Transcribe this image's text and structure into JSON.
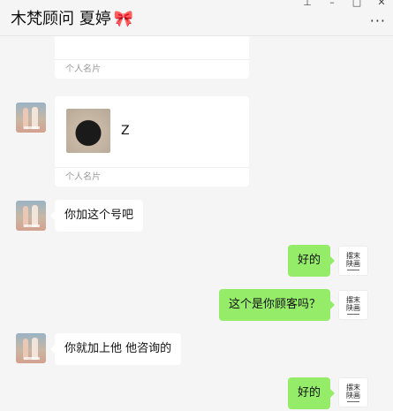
{
  "header": {
    "title": "木梵顾问 夏婷",
    "title_emoji": "🎀",
    "more_icon": "more-dots-icon",
    "window_controls": [
      "pin-icon",
      "minimize-icon",
      "maximize-icon",
      "close-icon"
    ]
  },
  "messages": [
    {
      "type": "contact_card",
      "side": "left",
      "footer": "个人名片",
      "truncated_top": true
    },
    {
      "type": "contact_card",
      "side": "left",
      "name": "Z",
      "footer": "个人名片"
    },
    {
      "type": "text",
      "side": "left",
      "text": "你加这个号吧"
    },
    {
      "type": "text",
      "side": "right",
      "text": "好的"
    },
    {
      "type": "text",
      "side": "right",
      "text": "这个是你顾客吗？"
    },
    {
      "type": "text",
      "side": "left",
      "text": "你就加上他 他咨询的"
    },
    {
      "type": "text",
      "side": "right",
      "text": "好的"
    }
  ],
  "my_avatar": {
    "line1": "摆末",
    "line2": "陕画"
  },
  "colors": {
    "background": "#f5f5f5",
    "my_bubble": "#95ec69",
    "their_bubble": "#ffffff"
  }
}
